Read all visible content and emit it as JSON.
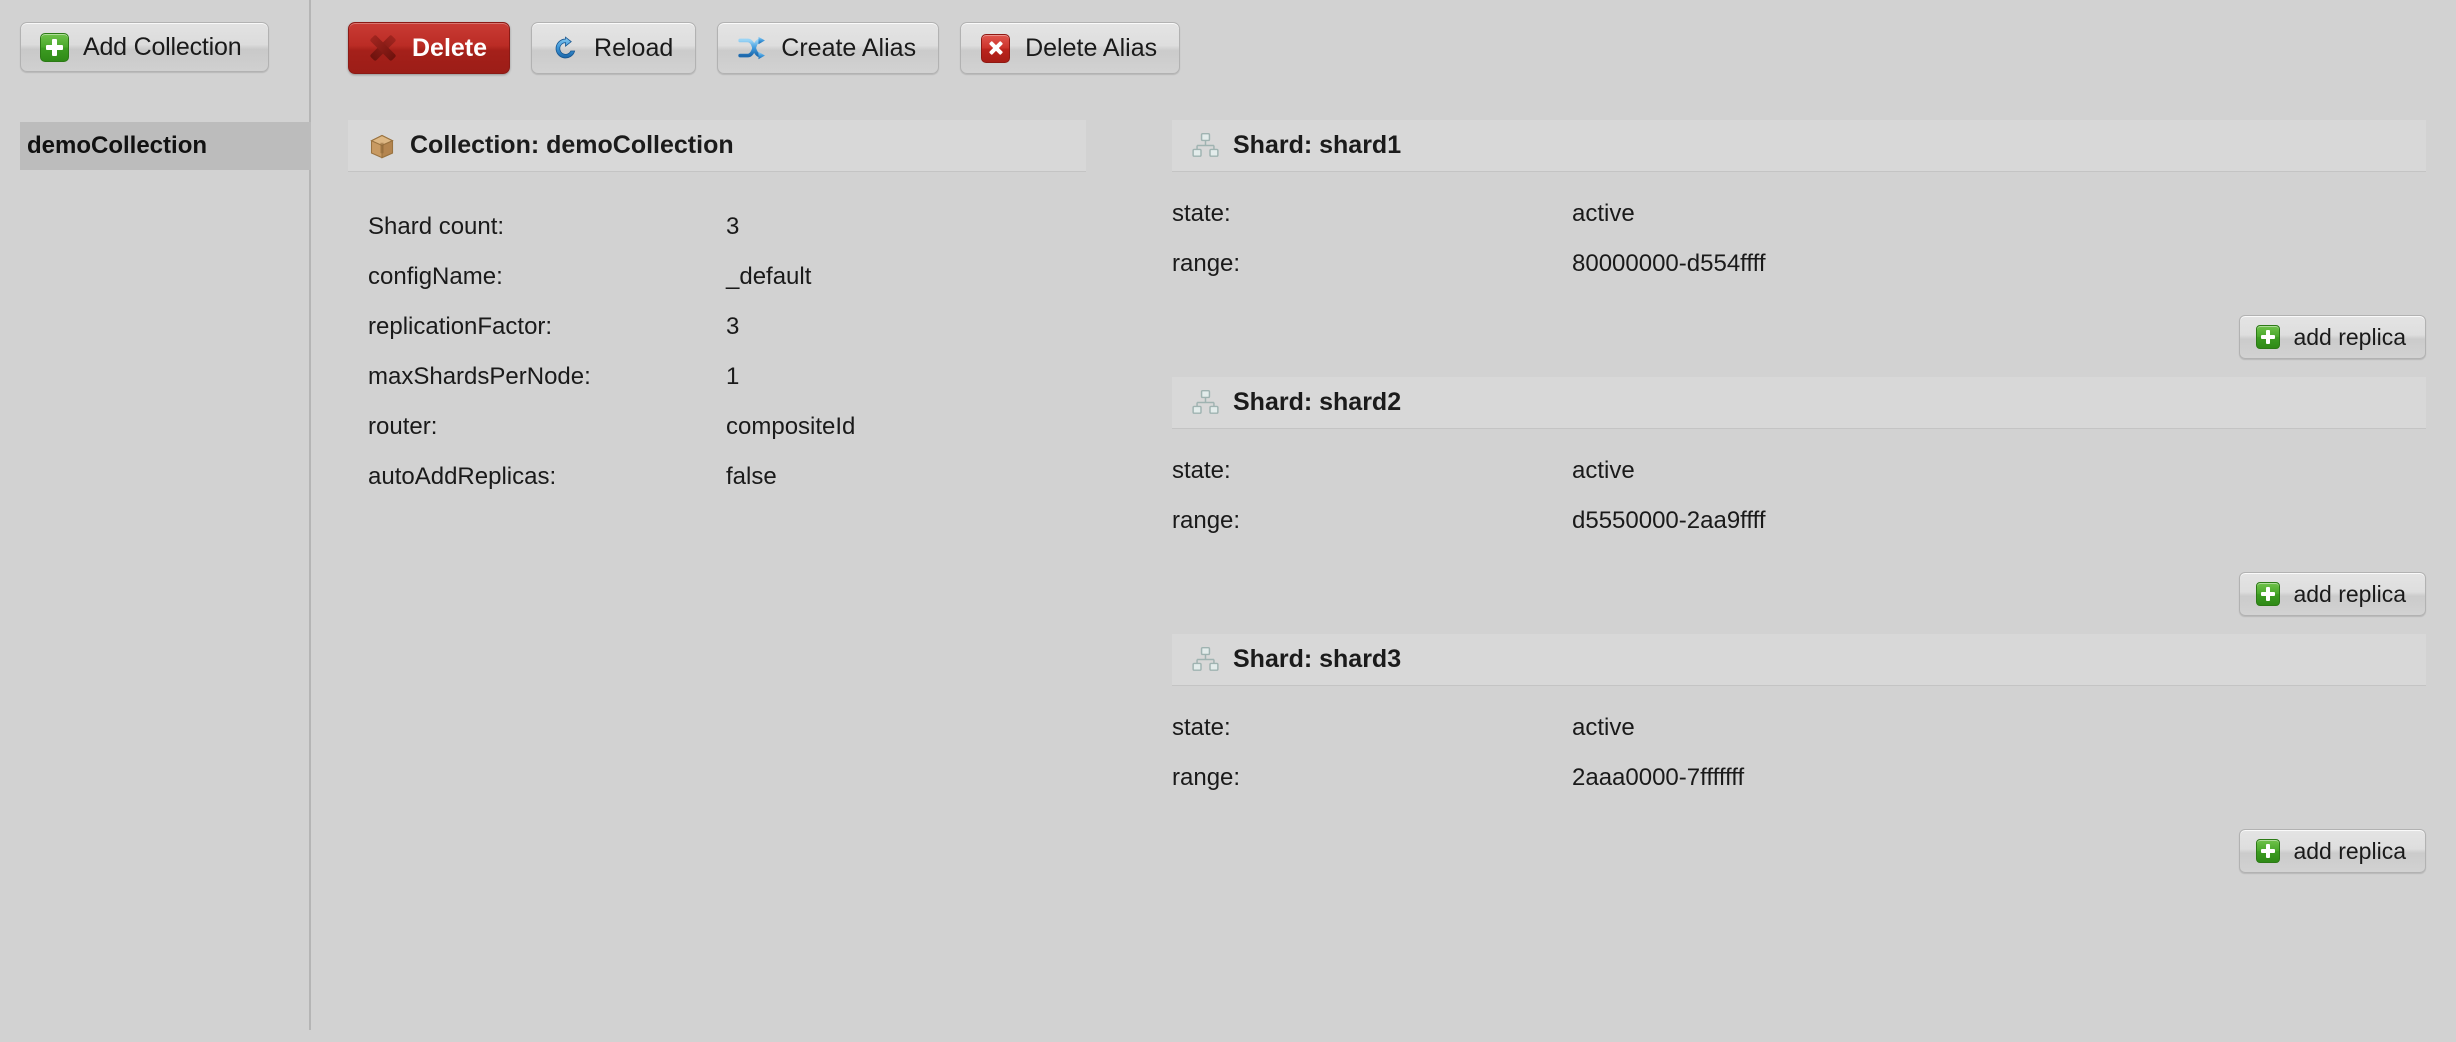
{
  "theme": {
    "page_bg": "#d2d2d2",
    "panel_header_bg": "#d8d8d8",
    "selected_item_bg": "#bcbcbc",
    "danger_red": "#bb2c25",
    "accent_green": "#4aa82c",
    "text_color": "#1a1a1a",
    "divider": "#b5b5b5"
  },
  "sidebar": {
    "add_collection": {
      "label": "Add Collection",
      "icon": "plus-icon"
    },
    "items": [
      {
        "label": "demoCollection",
        "selected": true
      }
    ]
  },
  "toolbar": {
    "buttons": [
      {
        "label": "Delete",
        "icon": "x-dark-icon",
        "style": "danger"
      },
      {
        "label": "Reload",
        "icon": "reload-icon",
        "style": "grey"
      },
      {
        "label": "Create Alias",
        "icon": "alias-icon",
        "style": "grey"
      },
      {
        "label": "Delete Alias",
        "icon": "x-red-box-icon",
        "style": "grey"
      }
    ]
  },
  "collection": {
    "header": "Collection: demoCollection",
    "header_icon": "package-icon",
    "properties": [
      {
        "key": "Shard count:",
        "value": "3"
      },
      {
        "key": "configName:",
        "value": "_default"
      },
      {
        "key": "replicationFactor:",
        "value": "3"
      },
      {
        "key": "maxShardsPerNode:",
        "value": "1"
      },
      {
        "key": "router:",
        "value": "compositeId"
      },
      {
        "key": "autoAddReplicas:",
        "value": "false"
      }
    ]
  },
  "shards": {
    "add_replica_label": "add replica",
    "state_key": "state:",
    "range_key": "range:",
    "list": [
      {
        "header": "Shard: shard1",
        "state": "active",
        "range": "80000000-d554ffff"
      },
      {
        "header": "Shard: shard2",
        "state": "active",
        "range": "d5550000-2aa9ffff"
      },
      {
        "header": "Shard: shard3",
        "state": "active",
        "range": "2aaa0000-7fffffff"
      }
    ]
  }
}
